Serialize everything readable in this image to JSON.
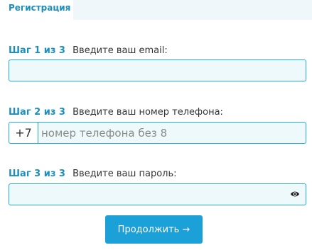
{
  "tabs": {
    "active": "Регистрация"
  },
  "step1": {
    "number": "Шаг 1 из 3",
    "label": "Введите ваш email:",
    "value": ""
  },
  "step2": {
    "number": "Шаг 2 из 3",
    "label": "Введите ваш номер телефона:",
    "prefix": "+7",
    "placeholder": "номер телефона без 8",
    "value": ""
  },
  "step3": {
    "number": "Шаг 3 из 3",
    "label": "Введите ваш пароль:",
    "value": "",
    "toggle_icon": "eye-icon"
  },
  "submit": {
    "label": "Продолжить →"
  },
  "colors": {
    "accent": "#1ba1d8",
    "field_bg": "#eef9fc",
    "tab_bg": "#f0f7fb"
  }
}
